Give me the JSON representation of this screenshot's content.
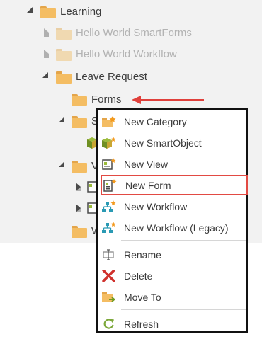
{
  "tree": {
    "learning": {
      "label": "Learning"
    },
    "hello_smartforms": {
      "label": "Hello World SmartForms"
    },
    "hello_workflow": {
      "label": "Hello World Workflow"
    },
    "leave_request": {
      "label": "Leave Request"
    },
    "forms": {
      "label": "Forms"
    },
    "smartobjects_partial": {
      "label": "S"
    },
    "views_partial": {
      "label": "V"
    },
    "workflows_partial": {
      "label": "W"
    }
  },
  "context_menu": {
    "items": [
      {
        "label": "New Category",
        "icon": "new-category-icon"
      },
      {
        "label": "New SmartObject",
        "icon": "new-smartobject-icon"
      },
      {
        "label": "New View",
        "icon": "new-view-icon"
      },
      {
        "label": "New Form",
        "icon": "new-form-icon",
        "highlighted": true
      },
      {
        "label": "New Workflow",
        "icon": "new-workflow-icon"
      },
      {
        "label": "New Workflow (Legacy)",
        "icon": "new-workflow-legacy-icon"
      },
      {
        "label": "Rename",
        "icon": "rename-icon"
      },
      {
        "label": "Delete",
        "icon": "delete-icon"
      },
      {
        "label": "Move To",
        "icon": "move-to-icon"
      },
      {
        "label": "Refresh",
        "icon": "refresh-icon"
      }
    ]
  },
  "colors": {
    "folder": "#f4bd63",
    "folder_faded": "#f0d9b1",
    "highlight_border": "#e24a43",
    "pointer_arrow": "#e0403b"
  }
}
